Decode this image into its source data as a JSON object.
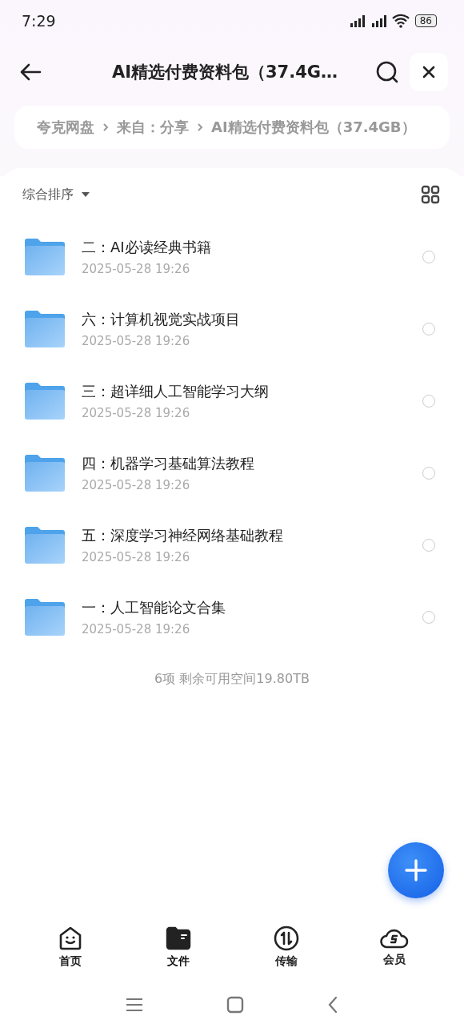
{
  "status_bar": {
    "time": "7:29",
    "battery": "86"
  },
  "header": {
    "title": "AI精选付费资料包（37.4G…"
  },
  "breadcrumb": [
    "夸克网盘",
    "来自：分享",
    "AI精选付费资料包（37.4GB）"
  ],
  "sort": {
    "label": "综合排序"
  },
  "files": [
    {
      "name": "二：AI必读经典书籍",
      "date": "2025-05-28 19:26",
      "selected": false
    },
    {
      "name": "六：计算机视觉实战项目",
      "date": "2025-05-28 19:26",
      "selected": false
    },
    {
      "name": "三：超详细人工智能学习大纲",
      "date": "2025-05-28 19:26",
      "selected": false
    },
    {
      "name": "四：机器学习基础算法教程",
      "date": "2025-05-28 19:26",
      "selected": false
    },
    {
      "name": "五：深度学习神经网络基础教程",
      "date": "2025-05-28 19:26",
      "selected": false
    },
    {
      "name": "一：人工智能论文合集",
      "date": "2025-05-28 19:26",
      "selected": false
    }
  ],
  "summary": "6项 剩余可用空间19.80TB",
  "tabs": [
    {
      "label": "首页",
      "kind": "home",
      "selected": false
    },
    {
      "label": "文件",
      "kind": "files",
      "selected": true
    },
    {
      "label": "传输",
      "kind": "transfer",
      "selected": false
    },
    {
      "label": "会员",
      "kind": "member",
      "selected": false
    }
  ]
}
